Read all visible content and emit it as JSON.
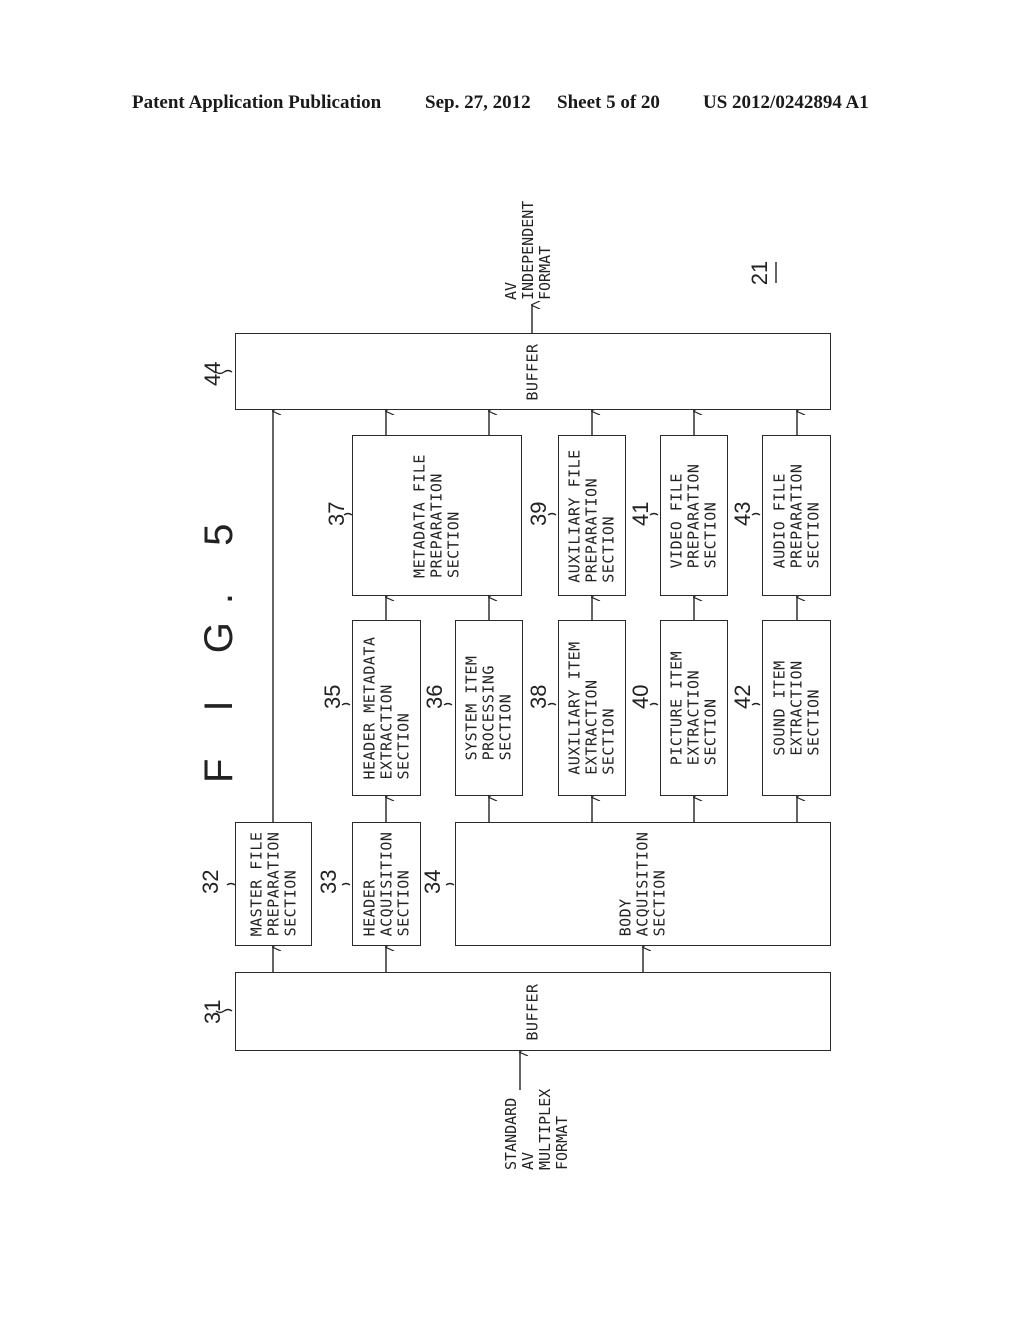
{
  "header": {
    "publication": "Patent Application Publication",
    "date": "Sep. 27, 2012",
    "sheet": "Sheet 5 of 20",
    "number": "US 2012/0242894 A1"
  },
  "figure": {
    "title": "F I G. 5",
    "device_ref": "21",
    "input_label": "STANDARD\nAV\nMULTIPLEX\nFORMAT",
    "output_label": "AV\nINDEPENDENT\nFORMAT"
  },
  "blocks": {
    "b31": {
      "ref": "31",
      "label": "BUFFER"
    },
    "b32": {
      "ref": "32",
      "label": "MASTER FILE\nPREPARATION\nSECTION"
    },
    "b33": {
      "ref": "33",
      "label": "HEADER\nACQUISITION\nSECTION"
    },
    "b34": {
      "ref": "34",
      "label": "BODY\nACQUISITION\nSECTION"
    },
    "b35": {
      "ref": "35",
      "label": "HEADER METADATA\nEXTRACTION\nSECTION"
    },
    "b36": {
      "ref": "36",
      "label": "SYSTEM ITEM\nPROCESSING\nSECTION"
    },
    "b37": {
      "ref": "37",
      "label": "METADATA FILE\nPREPARATION\nSECTION"
    },
    "b38": {
      "ref": "38",
      "label": "AUXILIARY ITEM\nEXTRACTION\nSECTION"
    },
    "b39": {
      "ref": "39",
      "label": "AUXILIARY FILE\nPREPARATION\nSECTION"
    },
    "b40": {
      "ref": "40",
      "label": "PICTURE ITEM\nEXTRACTION\nSECTION"
    },
    "b41": {
      "ref": "41",
      "label": "VIDEO FILE\nPREPARATION\nSECTION"
    },
    "b42": {
      "ref": "42",
      "label": "SOUND ITEM\nEXTRACTION\nSECTION"
    },
    "b43": {
      "ref": "43",
      "label": "AUDIO FILE\nPREPARATION\nSECTION"
    },
    "b44": {
      "ref": "44",
      "label": "BUFFER"
    }
  }
}
